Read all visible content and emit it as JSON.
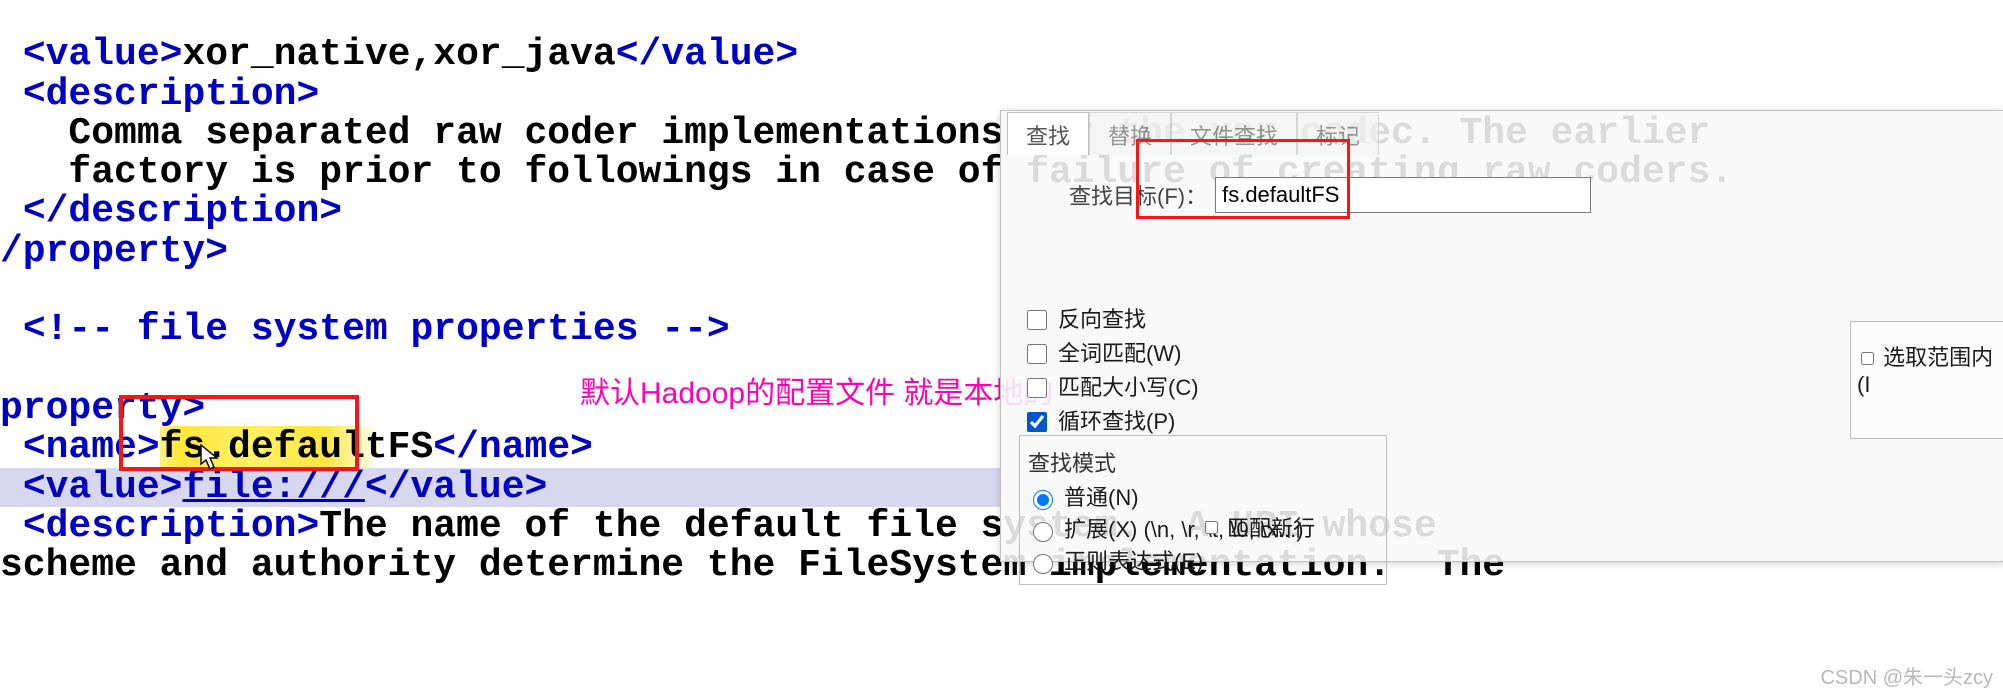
{
  "code": {
    "line1_val": "xor_native,xor_java",
    "line1_open": "<value>",
    "line1_close": "</value>",
    "line2": "<description>",
    "line3": "Comma separated raw coder implementations for the xor codec. The earlier",
    "line4": "factory is prior to followings in case of failure of creating raw coders.",
    "line5": "</description>",
    "line6": "/property>",
    "comment": "<!-- file system properties -->",
    "prop_open": "property>",
    "name_open": "<name>",
    "name_text": "fs.defaultFS",
    "name_close": "</name>",
    "value_open": "<value>",
    "value_text": "file:///",
    "value_close": "</value>",
    "desc_open": "<description>",
    "desc_text1": "The name of the default file system.  A URI whose",
    "desc_text2": "scheme and authority determine the FileSystem implementation.  The"
  },
  "annotation": "默认Hadoop的配置文件 就是本地的",
  "dialog": {
    "tabs": {
      "find": "查找",
      "replace": "替换",
      "files": "文件查找",
      "mark": "标记"
    },
    "search_label": "查找目标(F)：",
    "search_value": "fs.defaultFS",
    "scope_in_selection": "选取范围内(I",
    "opts": {
      "backward": "反向查找",
      "whole_word": "全词匹配(W)",
      "match_case": "匹配大小写(C)",
      "wrap": "循环查找(P)"
    },
    "mode_legend": "查找模式",
    "modes": {
      "normal": "普通(N)",
      "extended": "扩展(X) (\\n, \\r, \\t, \\0, \\x...)",
      "regex": "正则表达式(E)"
    },
    "newline": "匹配新行"
  },
  "watermark": "CSDN @朱一头zcy"
}
